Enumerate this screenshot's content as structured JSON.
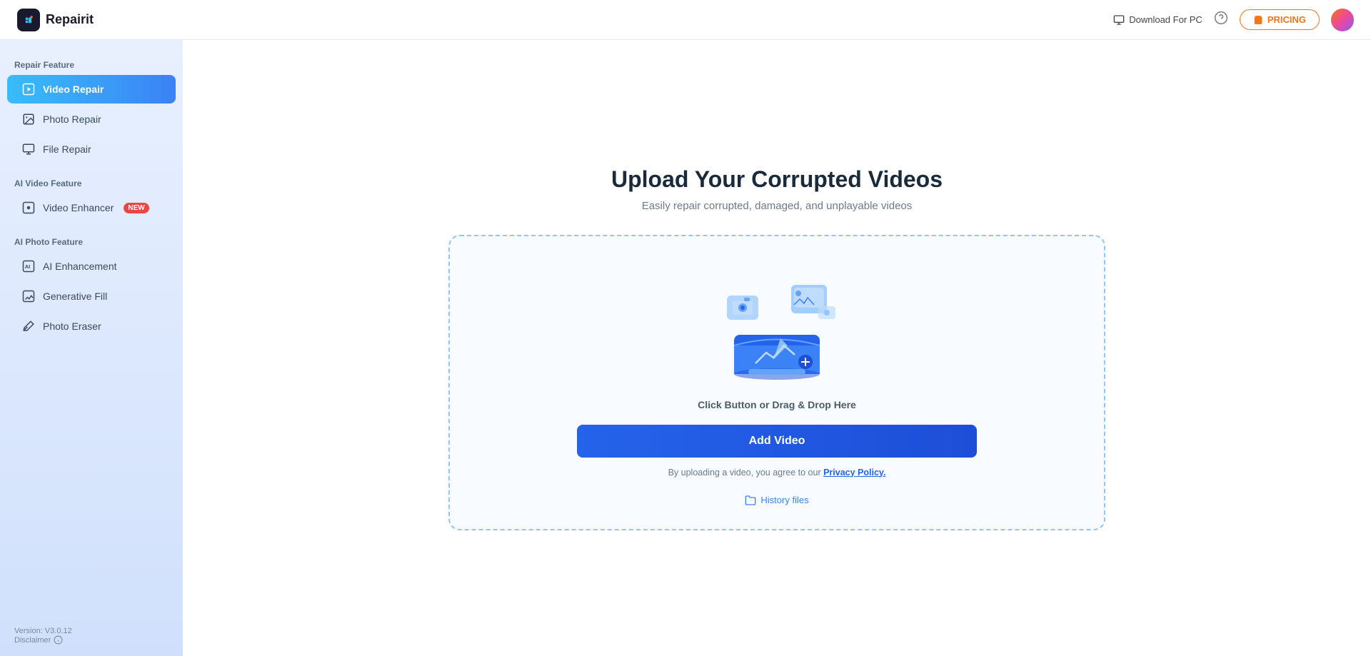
{
  "app": {
    "logo_text": "Repairit"
  },
  "header": {
    "download_label": "Download For PC",
    "pricing_label": "PRICING"
  },
  "sidebar": {
    "repair_feature_label": "Repair Feature",
    "ai_video_label": "AI Video Feature",
    "ai_photo_label": "AI Photo Feature",
    "items": {
      "video_repair": "Video Repair",
      "photo_repair": "Photo Repair",
      "file_repair": "File Repair",
      "video_enhancer": "Video Enhancer",
      "ai_enhancement": "AI Enhancement",
      "generative_fill": "Generative Fill",
      "photo_eraser": "Photo Eraser"
    },
    "new_badge": "NEW",
    "version": "Version: V3.0.12",
    "disclaimer": "Disclaimer"
  },
  "main": {
    "title": "Upload Your Corrupted Videos",
    "subtitle": "Easily repair corrupted, damaged, and unplayable videos",
    "upload_hint": "Click Button or Drag & Drop Here",
    "add_video_label": "Add Video",
    "privacy_text_before": "By uploading a video, you agree to our ",
    "privacy_link": "Privacy Policy.",
    "history_label": "History files"
  }
}
